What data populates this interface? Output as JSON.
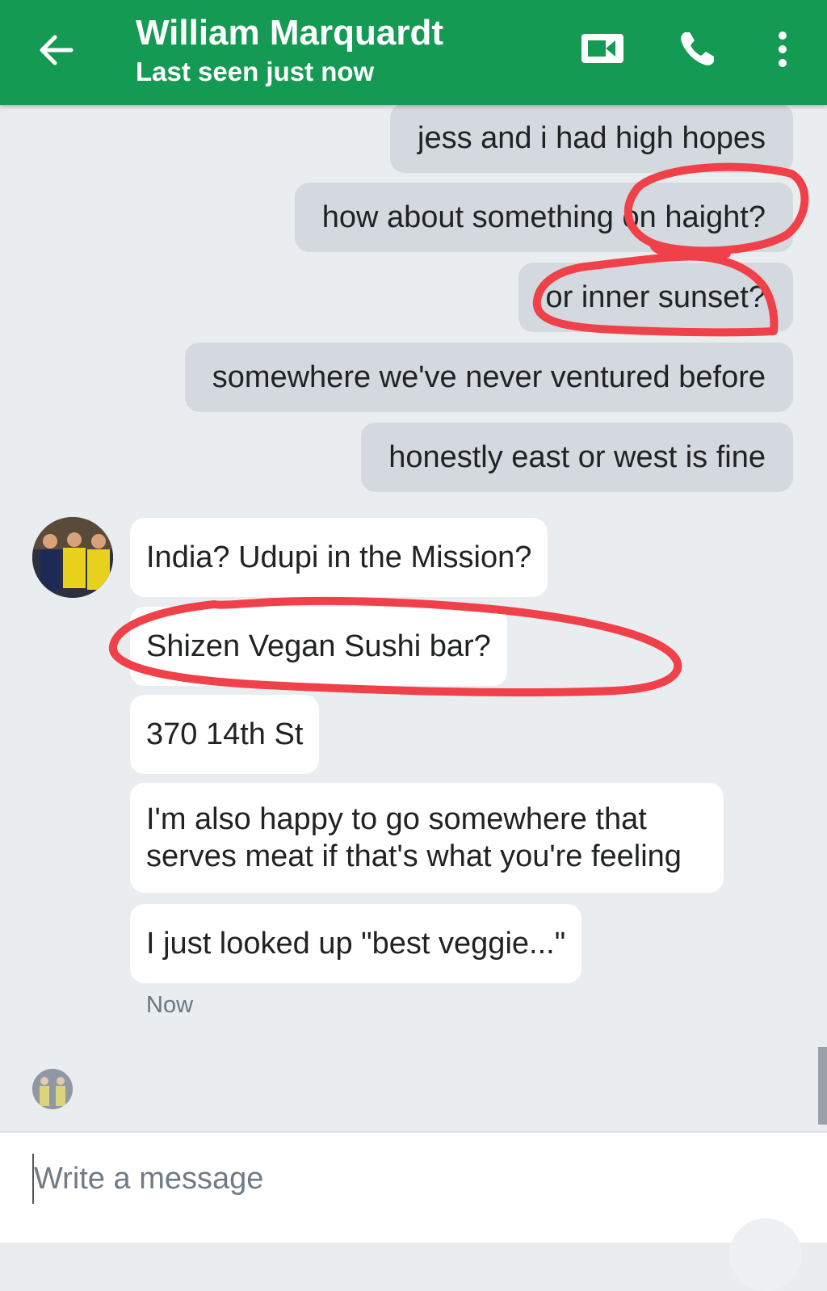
{
  "header": {
    "contact_name": "William Marquardt",
    "status": "Last seen just now",
    "back_icon": "arrow-left-icon",
    "video_icon": "video-camera-icon",
    "call_icon": "phone-icon",
    "menu_icon": "more-vert-icon",
    "color": "#159a54"
  },
  "messages": {
    "outgoing": [
      "jess and i had high hopes",
      "how about something on haight?",
      "or inner sunset?",
      "somewhere we've never ventured before",
      "honestly east or west is fine"
    ],
    "incoming": [
      "India? Udupi in the Mission?",
      "Shizen Vegan Sushi bar?",
      "370 14th St",
      "I'm also happy to go somewhere that serves meat if that's what you're feeling",
      "I just looked up \"best veggie...\""
    ],
    "timestamp": "Now"
  },
  "composer": {
    "placeholder": "Write a message"
  },
  "annotation_color": "#f0404a"
}
